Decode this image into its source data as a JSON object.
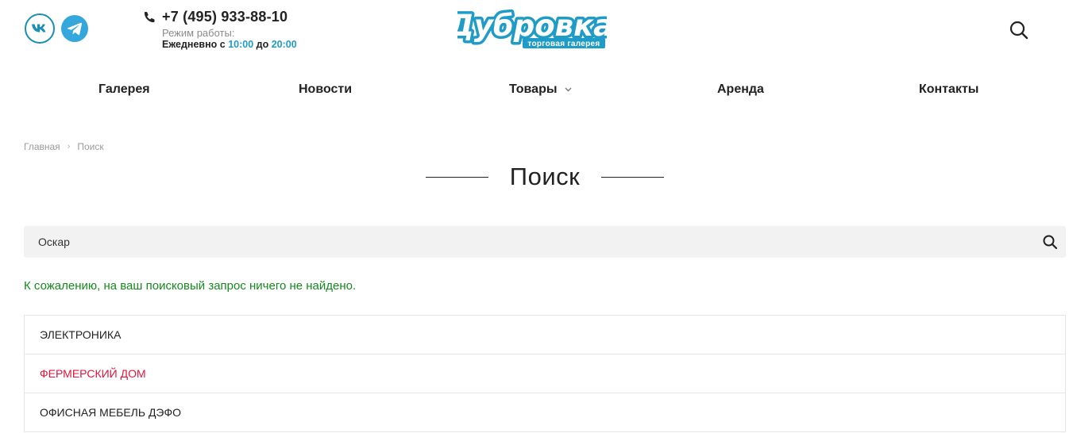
{
  "social": {
    "vk_icon": "vk-icon",
    "telegram_icon": "telegram-icon"
  },
  "contact": {
    "phone_icon": "phone-icon",
    "phone": "+7 (495) 933-88-10",
    "hours_label": "Режим работы:",
    "hours_prefix": "Ежедневно с ",
    "hours_from": "10:00",
    "hours_mid": " до ",
    "hours_to": "20:00",
    "accent_color": "#1e9cc7"
  },
  "logo": {
    "name": "Дубровка",
    "tagline": "торговая галерея",
    "color": "#1e9cc7"
  },
  "nav": {
    "items": [
      {
        "label": "Галерея"
      },
      {
        "label": "Новости"
      },
      {
        "label": "Товары",
        "has_dropdown": true
      },
      {
        "label": "Аренда"
      },
      {
        "label": "Контакты"
      }
    ]
  },
  "breadcrumb": {
    "home": "Главная",
    "separator": "›",
    "current": "Поиск"
  },
  "page": {
    "title": "Поиск"
  },
  "search": {
    "value": "Оскар",
    "icon": "search-icon"
  },
  "results": {
    "message": "К сожалению, на ваш поисковый запрос ничего не найдено.",
    "message_color": "#158a1e",
    "items": [
      {
        "label": "ЭЛЕКТРОНИКА"
      },
      {
        "label": "ФЕРМЕРСКИЙ ДОМ",
        "highlight_color": "#e0143c"
      },
      {
        "label": "ОФИСНАЯ МЕБЕЛЬ ДЭФО"
      }
    ]
  }
}
